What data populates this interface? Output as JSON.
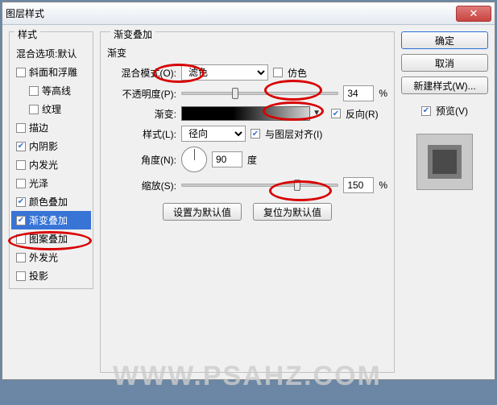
{
  "window": {
    "title": "图层样式"
  },
  "leftPanel": {
    "heading": "样式",
    "blendDefault": "混合选项:默认",
    "items": [
      {
        "label": "斜面和浮雕",
        "checked": false,
        "indent": false
      },
      {
        "label": "等高线",
        "checked": false,
        "indent": true
      },
      {
        "label": "纹理",
        "checked": false,
        "indent": true
      },
      {
        "label": "描边",
        "checked": false,
        "indent": false
      },
      {
        "label": "内阴影",
        "checked": true,
        "indent": false
      },
      {
        "label": "内发光",
        "checked": false,
        "indent": false
      },
      {
        "label": "光泽",
        "checked": false,
        "indent": false
      },
      {
        "label": "颜色叠加",
        "checked": true,
        "indent": false
      },
      {
        "label": "渐变叠加",
        "checked": true,
        "indent": false,
        "selected": true
      },
      {
        "label": "图案叠加",
        "checked": false,
        "indent": false
      },
      {
        "label": "外发光",
        "checked": false,
        "indent": false
      },
      {
        "label": "投影",
        "checked": false,
        "indent": false
      }
    ]
  },
  "mid": {
    "sectionTitle": "渐变叠加",
    "subTitle": "渐变",
    "blendMode": {
      "label": "混合模式(O):",
      "value": "滤色",
      "dither": "仿色",
      "ditherChecked": false
    },
    "opacity": {
      "label": "不透明度(P):",
      "value": "34",
      "unit": "%"
    },
    "gradient": {
      "label": "渐变:",
      "reverse": "反向(R)",
      "reverseChecked": true
    },
    "style": {
      "label": "样式(L):",
      "value": "径向",
      "align": "与图层对齐(I)",
      "alignChecked": true
    },
    "angle": {
      "label": "角度(N):",
      "value": "90",
      "unit": "度"
    },
    "scale": {
      "label": "缩放(S):",
      "value": "150",
      "unit": "%"
    },
    "btnDefault": "设置为默认值",
    "btnReset": "复位为默认值"
  },
  "right": {
    "ok": "确定",
    "cancel": "取消",
    "newStyle": "新建样式(W)...",
    "preview": "预览(V)",
    "previewChecked": true
  },
  "watermark": "WWW.PSAHZ.COM"
}
